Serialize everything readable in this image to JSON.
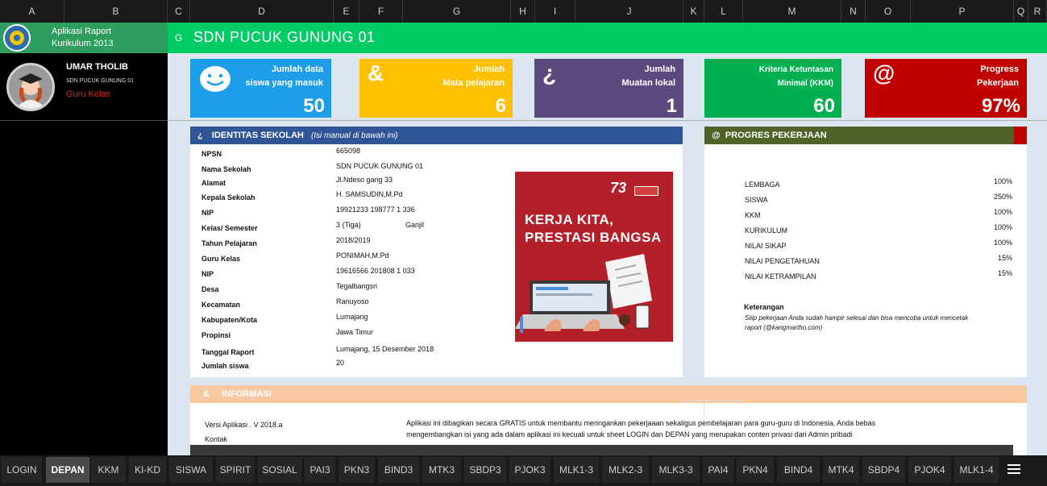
{
  "columns": [
    "A",
    "B",
    "C",
    "D",
    "E",
    "F",
    "G",
    "H",
    "I",
    "J",
    "K",
    "L",
    "M",
    "N",
    "O",
    "P",
    "Q",
    "R"
  ],
  "app": {
    "line1": "Aplikasi Raport",
    "line2": "Kurikulum 2013"
  },
  "user": {
    "name": "UMAR THOLIB",
    "school": "SDN PUCUK GUNUNG 01",
    "role": "Guru Kelas"
  },
  "banner": {
    "icon": "G",
    "title": "SDN PUCUK GUNUNG 01"
  },
  "tiles": [
    {
      "icon": "smiley-icon",
      "line1": "Jumlah data",
      "line2": "siswa yang masuk",
      "value": "50",
      "color": "#1e9ee8"
    },
    {
      "icon": "&",
      "line1": "Jumlah",
      "line2": "Mata pelajaran",
      "value": "6",
      "color": "#ffc000"
    },
    {
      "icon": "¿",
      "line1": "Jumlah",
      "line2": "Muatan lokal",
      "value": "1",
      "color": "#5c4a7e"
    },
    {
      "icon": "",
      "line1": "Kriteria Ketuntasan",
      "line2": "Minimal (KKM)",
      "value": "60",
      "color": "#00b050"
    },
    {
      "icon": "@",
      "line1": "Progress",
      "line2": "Pekerjaan",
      "value": "97%",
      "color": "#c00000"
    }
  ],
  "identitas": {
    "icon": "¿",
    "title": "IDENTITAS SEKOLAH",
    "subtitle": "(Isi manual di bawah ini)",
    "rows": [
      {
        "label": "NPSN",
        "value": "665098"
      },
      {
        "label": "Nama Sekolah",
        "value": "SDN PUCUK GUNUNG 01"
      },
      {
        "label": "Alamat",
        "value": "Jl.Ndeso gang 33"
      },
      {
        "label": "Kepala Sekolah",
        "value": "H. SAMSUDIN,M.Pd"
      },
      {
        "label": "NIP",
        "value": "19921233 198777 1 336"
      },
      {
        "label": "Kelas/ Semester",
        "value": "3 (Tiga)",
        "extra": "Ganjil"
      },
      {
        "label": "Tahun Pelajaran",
        "value": "2018/2019"
      },
      {
        "label": "Guru Kelas",
        "value": "PONIMAH,M.Pd"
      },
      {
        "label": "NIP",
        "value": "19616566 201808 1 033"
      },
      {
        "label": "Desa",
        "value": "Tegalbangsri"
      },
      {
        "label": "Kecamatan",
        "value": "Ranuyoso"
      },
      {
        "label": "Kabupaten/Kota",
        "value": "Lumajang"
      },
      {
        "label": "Propinsi",
        "value": "Jawa Timur"
      },
      {
        "label": "Tanggal Raport",
        "value": "Lumajang, 15 Desember 2018"
      },
      {
        "label": "Jumlah siswa",
        "value": "20"
      }
    ]
  },
  "poster": {
    "badge": "73",
    "line1": "KERJA KITA,",
    "line2": "PRESTASI BANGSA"
  },
  "progres": {
    "icon": "@",
    "title": "PROGRES PEKERJAAN",
    "items": [
      {
        "label": "LEMBAGA",
        "value": "100%"
      },
      {
        "label": "SISWA",
        "value": "250%"
      },
      {
        "label": "KKM",
        "value": "100%"
      },
      {
        "label": "KURIKULUM",
        "value": "100%"
      },
      {
        "label": "NILAI SIKAP",
        "value": "100%"
      },
      {
        "label": "NILAI PENGETAHUAN",
        "value": "15%"
      },
      {
        "label": "NILAI KETRAMPILAN",
        "value": "15%"
      }
    ],
    "keterangan_title": "Keterangan",
    "keterangan_text1": "Siiip pekerjaan Anda sudah hampir selesai dan bisa mencoba untuk mencetak",
    "keterangan_text2": "raport (@kangmartho.com)"
  },
  "informasi": {
    "icon": "&",
    "title": "INFORMASI",
    "versi": "Versi Aplikasi . V 2018.a",
    "kontak": "Kontak",
    "text1": "Aplikasi ini dibagikan secara GRATIS untuk membantu meringankan pekerjaaan sekaligus pembelajaran para guru-guru di Indonesia, Anda bebas",
    "text2": "mengembangkan isi yang ada dalam aplikasi ini kecuali untuk sheet LOGIN dan DEPAN yang merupakan conten privasi dari Admin pribadi"
  },
  "tabs": [
    "LOGIN",
    "DEPAN",
    "KKM",
    "KI-KD",
    "SISWA",
    "SPIRIT",
    "SOSIAL",
    "PAI3",
    "PKN3",
    "BIND3",
    "MTK3",
    "SBDP3",
    "PJOK3",
    "MLK1-3",
    "MLK2-3",
    "MLK3-3",
    "PAI4",
    "PKN4",
    "BIND4",
    "MTK4",
    "SBDP4",
    "PJOK4",
    "MLK1-4"
  ],
  "active_tab": "DEPAN"
}
